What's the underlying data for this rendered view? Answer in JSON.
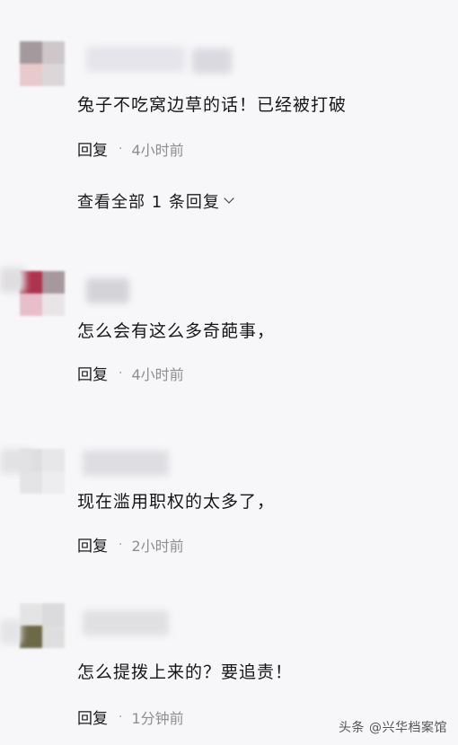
{
  "comments": [
    {
      "text": "兔子不吃窝边草的话！已经被打破",
      "reply_label": "回复",
      "separator": "·",
      "time": "4小时前",
      "view_all": "查看全部 1 条回复"
    },
    {
      "text": "怎么会有这么多奇葩事，",
      "reply_label": "回复",
      "separator": "·",
      "time": "4小时前"
    },
    {
      "text": "现在滥用职权的太多了，",
      "reply_label": "回复",
      "separator": "·",
      "time": "2小时前"
    },
    {
      "text": "怎么提拨上来的？要追责！",
      "reply_label": "回复",
      "separator": "·",
      "time": "1分钟前"
    }
  ],
  "watermark": "头条 @兴华档案馆",
  "icons": {
    "view_all_chevron": "chevron-down-icon"
  }
}
